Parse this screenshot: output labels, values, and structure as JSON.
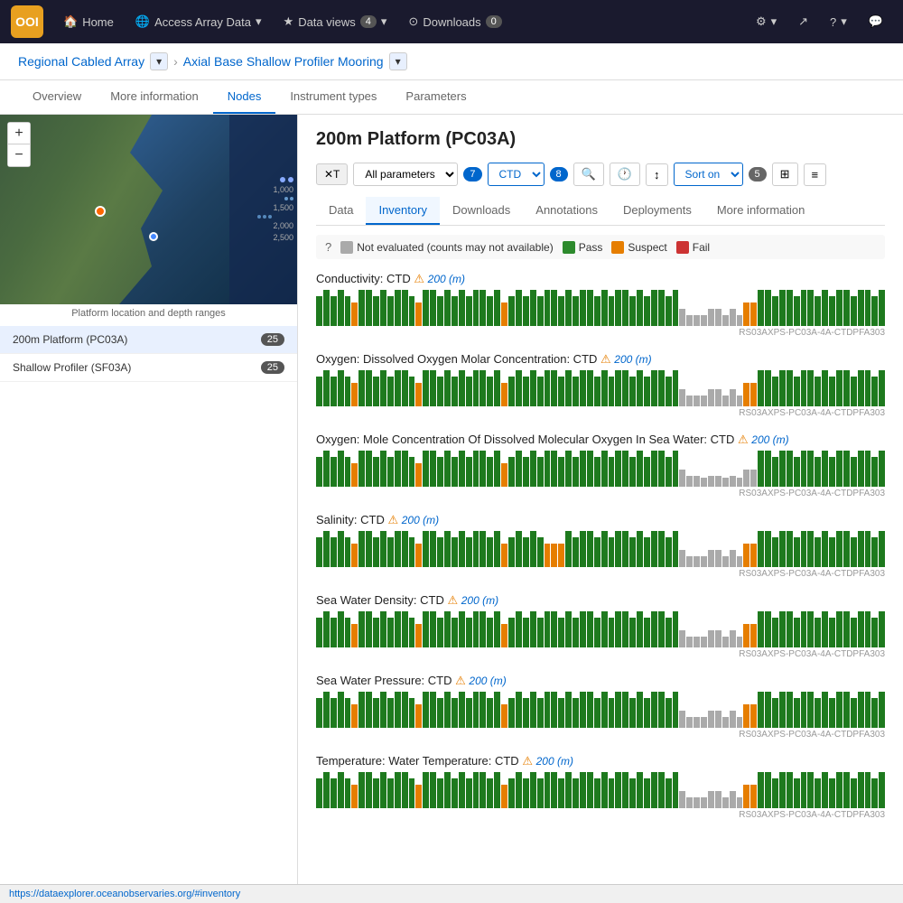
{
  "nav": {
    "logo": "OOI",
    "items": [
      {
        "id": "home",
        "label": "Home",
        "icon": "🏠"
      },
      {
        "id": "access-array-data",
        "label": "Access Array Data",
        "icon": "🌐",
        "hasDropdown": true
      },
      {
        "id": "data-views",
        "label": "Data views",
        "icon": "★",
        "badge": "4",
        "hasDropdown": true
      },
      {
        "id": "downloads",
        "label": "Downloads",
        "icon": "⊙",
        "badge": "0",
        "hasDropdown": false
      }
    ],
    "right_items": [
      {
        "id": "settings",
        "icon": "⚙",
        "hasDropdown": true
      },
      {
        "id": "share",
        "icon": "↗"
      },
      {
        "id": "help",
        "icon": "?",
        "hasDropdown": true
      },
      {
        "id": "chat",
        "icon": "💬"
      }
    ]
  },
  "breadcrumb": {
    "items": [
      {
        "label": "Regional Cabled Array",
        "hasDropdown": true
      },
      {
        "label": "Axial Base Shallow Profiler Mooring",
        "hasDropdown": true
      }
    ]
  },
  "tabs": [
    "Overview",
    "More information",
    "Nodes",
    "Instrument types",
    "Parameters"
  ],
  "active_tab": "Nodes",
  "left_panel": {
    "map_label": "Platform location and depth ranges",
    "nodes": [
      {
        "id": "pc03a",
        "label": "200m Platform (PC03A)",
        "badge": "25",
        "active": true
      },
      {
        "id": "sf03a",
        "label": "Shallow Profiler (SF03A)",
        "badge": "25",
        "active": false
      }
    ]
  },
  "right_panel": {
    "platform_title": "200m Platform (PC03A)",
    "filter_bar": {
      "clear_label": "✕T",
      "param_select": "All parameters",
      "param_badge": "7",
      "ctd_select": "CTD",
      "ctd_badge": "8",
      "icons": [
        "🔍",
        "🕐",
        "↕",
        "⊞",
        "≡"
      ],
      "sort_label": "Sort on",
      "sort_badge": "5"
    },
    "inner_tabs": [
      "Data",
      "Inventory",
      "Downloads",
      "Annotations",
      "Deployments",
      "More information"
    ],
    "active_inner_tab": "Inventory",
    "legend": {
      "icon": "?",
      "items": [
        {
          "label": "Not evaluated (counts may not available)",
          "color": "#aaa"
        },
        {
          "label": "Pass",
          "color": "#2d8a2d"
        },
        {
          "label": "Suspect",
          "color": "#e67e00"
        },
        {
          "label": "Fail",
          "color": "#cc3333"
        }
      ]
    },
    "datasets": [
      {
        "id": "conductivity",
        "title": "Conductivity: CTD",
        "units": "200 (m)",
        "ref": "RS03AXPS-PC03A-4A-CTDPFA303",
        "bars": [
          4,
          5,
          4,
          5,
          4,
          3,
          5,
          5,
          4,
          5,
          4,
          5,
          5,
          4,
          3,
          5,
          5,
          4,
          5,
          4,
          5,
          4,
          5,
          5,
          4,
          5,
          3,
          4,
          5,
          4,
          5,
          4,
          5,
          5,
          4,
          5,
          4,
          5,
          5,
          4,
          5,
          4,
          5,
          5,
          4,
          5,
          4,
          5,
          5,
          4,
          5,
          2,
          1,
          1,
          1,
          2,
          2,
          1,
          2,
          1,
          3,
          3,
          5,
          5,
          4,
          5,
          5,
          4,
          5,
          5,
          4,
          5,
          4,
          5,
          5,
          4,
          5,
          5,
          4,
          5
        ]
      },
      {
        "id": "oxygen-molar",
        "title": "Oxygen: Dissolved Oxygen Molar Concentration: CTD",
        "units": "200 (m)",
        "ref": "RS03AXPS-PC03A-4A-CTDPFA303",
        "bars": [
          4,
          5,
          4,
          5,
          4,
          3,
          5,
          5,
          4,
          5,
          4,
          5,
          5,
          4,
          3,
          5,
          5,
          4,
          5,
          4,
          5,
          4,
          5,
          5,
          4,
          5,
          3,
          4,
          5,
          4,
          5,
          4,
          5,
          5,
          4,
          5,
          4,
          5,
          5,
          4,
          5,
          4,
          5,
          5,
          4,
          5,
          4,
          5,
          5,
          4,
          5,
          2,
          1,
          1,
          1,
          2,
          2,
          1,
          2,
          1,
          3,
          3,
          5,
          5,
          4,
          5,
          5,
          4,
          5,
          5,
          4,
          5,
          4,
          5,
          5,
          4,
          5,
          5,
          4,
          5
        ]
      },
      {
        "id": "oxygen-molecular",
        "title": "Oxygen: Mole Concentration Of Dissolved Molecular Oxygen In Sea Water: CTD",
        "units": "200 (m)",
        "ref": "RS03AXPS-PC03A-4A-CTDPFA303",
        "bars": [
          4,
          5,
          4,
          5,
          4,
          3,
          5,
          5,
          4,
          5,
          4,
          5,
          5,
          4,
          3,
          5,
          5,
          4,
          5,
          4,
          5,
          4,
          5,
          5,
          4,
          5,
          3,
          4,
          5,
          4,
          5,
          4,
          5,
          5,
          4,
          5,
          4,
          5,
          5,
          4,
          5,
          4,
          5,
          5,
          4,
          5,
          4,
          5,
          5,
          4,
          5,
          2,
          1,
          1,
          0,
          1,
          1,
          0,
          1,
          0,
          2,
          2,
          5,
          5,
          4,
          5,
          5,
          4,
          5,
          5,
          4,
          5,
          4,
          5,
          5,
          4,
          5,
          5,
          4,
          5
        ]
      },
      {
        "id": "salinity",
        "title": "Salinity: CTD",
        "units": "200 (m)",
        "ref": "RS03AXPS-PC03A-4A-CTDPFA303",
        "bars": [
          4,
          5,
          4,
          5,
          4,
          3,
          5,
          5,
          4,
          5,
          4,
          5,
          5,
          4,
          3,
          5,
          5,
          4,
          5,
          4,
          5,
          4,
          5,
          5,
          4,
          5,
          3,
          4,
          5,
          4,
          5,
          4,
          3,
          3,
          3,
          5,
          4,
          5,
          5,
          4,
          5,
          4,
          5,
          5,
          4,
          5,
          4,
          5,
          5,
          4,
          5,
          2,
          1,
          1,
          1,
          2,
          2,
          1,
          2,
          1,
          3,
          3,
          5,
          5,
          4,
          5,
          5,
          4,
          5,
          5,
          4,
          5,
          4,
          5,
          5,
          4,
          5,
          5,
          4,
          5
        ]
      },
      {
        "id": "density",
        "title": "Sea Water Density: CTD",
        "units": "200 (m)",
        "ref": "RS03AXPS-PC03A-4A-CTDPFA303",
        "bars": [
          4,
          5,
          4,
          5,
          4,
          3,
          5,
          5,
          4,
          5,
          4,
          5,
          5,
          4,
          3,
          5,
          5,
          4,
          5,
          4,
          5,
          4,
          5,
          5,
          4,
          5,
          3,
          4,
          5,
          4,
          5,
          4,
          5,
          5,
          4,
          5,
          4,
          5,
          5,
          4,
          5,
          4,
          5,
          5,
          4,
          5,
          4,
          5,
          5,
          4,
          5,
          2,
          1,
          1,
          1,
          2,
          2,
          1,
          2,
          1,
          3,
          3,
          5,
          5,
          4,
          5,
          5,
          4,
          5,
          5,
          4,
          5,
          4,
          5,
          5,
          4,
          5,
          5,
          4,
          5
        ]
      },
      {
        "id": "pressure",
        "title": "Sea Water Pressure: CTD",
        "units": "200 (m)",
        "ref": "RS03AXPS-PC03A-4A-CTDPFA303",
        "bars": [
          4,
          5,
          4,
          5,
          4,
          3,
          5,
          5,
          4,
          5,
          4,
          5,
          5,
          4,
          3,
          5,
          5,
          4,
          5,
          4,
          5,
          4,
          5,
          5,
          4,
          5,
          3,
          4,
          5,
          4,
          5,
          4,
          5,
          5,
          4,
          5,
          4,
          5,
          5,
          4,
          5,
          4,
          5,
          5,
          4,
          5,
          4,
          5,
          5,
          4,
          5,
          2,
          1,
          1,
          1,
          2,
          2,
          1,
          2,
          1,
          3,
          3,
          5,
          5,
          4,
          5,
          5,
          4,
          5,
          5,
          4,
          5,
          4,
          5,
          5,
          4,
          5,
          5,
          4,
          5
        ]
      },
      {
        "id": "temperature",
        "title": "Temperature: Water Temperature: CTD",
        "units": "200 (m)",
        "ref": "RS03AXPS-PC03A-4A-CTDPFA303",
        "bars": [
          4,
          5,
          4,
          5,
          4,
          3,
          5,
          5,
          4,
          5,
          4,
          5,
          5,
          4,
          3,
          5,
          5,
          4,
          5,
          4,
          5,
          4,
          5,
          5,
          4,
          5,
          3,
          4,
          5,
          4,
          5,
          4,
          5,
          5,
          4,
          5,
          4,
          5,
          5,
          4,
          5,
          4,
          5,
          5,
          4,
          5,
          4,
          5,
          5,
          4,
          5,
          2,
          1,
          1,
          1,
          2,
          2,
          1,
          2,
          1,
          3,
          3,
          5,
          5,
          4,
          5,
          5,
          4,
          5,
          5,
          4,
          5,
          4,
          5,
          5,
          4,
          5,
          5,
          4,
          5
        ]
      }
    ]
  },
  "url_bar": "https://dataexplorer.oceanobservaries.org/#inventory"
}
